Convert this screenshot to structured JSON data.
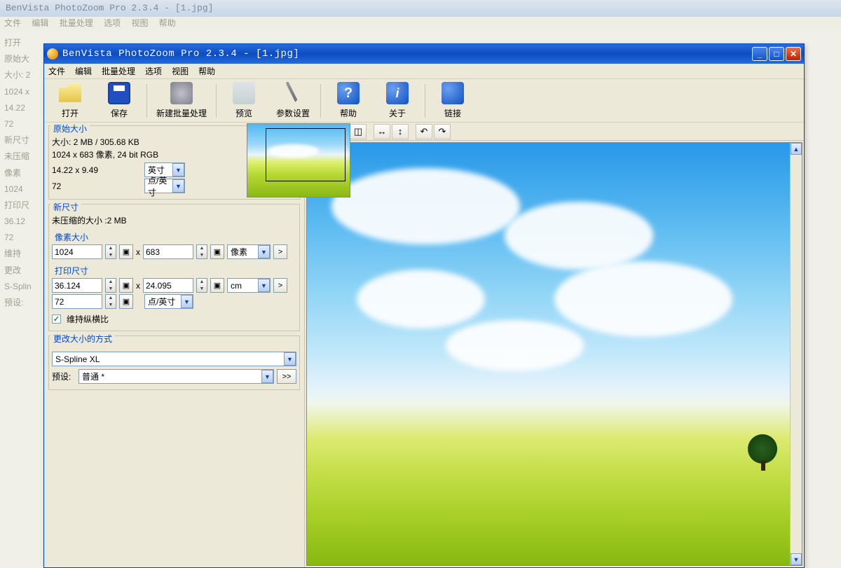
{
  "bg_window": {
    "title": "BenVista PhotoZoom Pro 2.3.4 - [1.jpg]",
    "menu": [
      "文件",
      "编辑",
      "批量处理",
      "选项",
      "视图",
      "帮助"
    ],
    "left_items": [
      "打开",
      "原始大",
      "大小: 2",
      "1024 x",
      "14.22",
      "72",
      "新尺寸",
      "未压缩",
      "像素",
      "1024",
      "打印尺",
      "36.12",
      "72",
      "维持",
      "更改",
      "S-Splin",
      "预设:"
    ]
  },
  "window": {
    "title": "BenVista PhotoZoom Pro 2.3.4 - [1.jpg]",
    "menu": [
      "文件",
      "编辑",
      "批量处理",
      "选项",
      "视图",
      "帮助"
    ]
  },
  "toolbar": {
    "open": "打开",
    "save": "保存",
    "batch": "新建批量处理",
    "preview": "预览",
    "settings": "参数设置",
    "help": "帮助",
    "about": "关于",
    "link": "链接"
  },
  "original": {
    "legend": "原始大小",
    "size_line": "大小: 2 MB / 305.68 KB",
    "dim_line": "1024 x 683 像素, 24 bit RGB",
    "dim_inch": "14.22 x 9.49",
    "unit_inch": "英寸",
    "dpi": "72",
    "unit_dpi": "点/英寸"
  },
  "newsize": {
    "legend": "新尺寸",
    "uncompressed": "未压缩的大小 :2 MB",
    "pixel_legend": "像素大小",
    "width_px": "1024",
    "height_px": "683",
    "unit_px": "像素",
    "print_legend": "打印尺寸",
    "width_cm": "36.124",
    "height_cm": "24.095",
    "unit_cm": "cm",
    "dpi": "72",
    "unit_dpi": "点/英寸",
    "keep_ratio": "维持纵横比"
  },
  "resize": {
    "legend": "更改大小的方式",
    "method": "S-Spline XL",
    "preset_label": "预设:",
    "preset_value": "普通 *"
  },
  "misc": {
    "x": "x",
    "go": ">",
    "goright": ">>",
    "lock": "▣",
    "check": "✓"
  }
}
